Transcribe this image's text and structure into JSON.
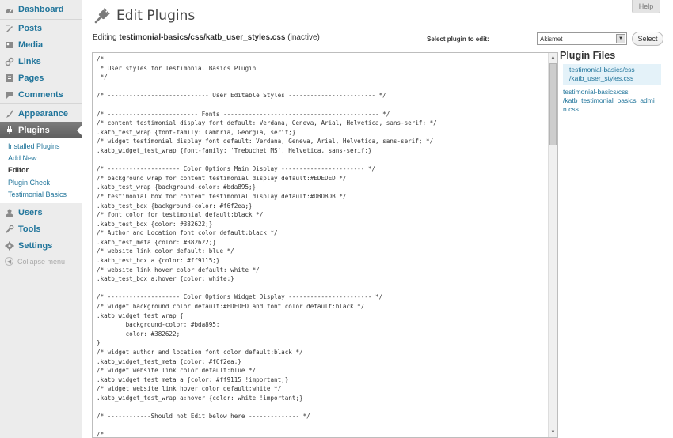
{
  "header": {
    "title": "Edit Plugins",
    "help": "Help",
    "editing_prefix": "Editing",
    "editing_file": "testimonial-basics/css/katb_user_styles.css",
    "editing_status": "(inactive)",
    "select_label": "Select plugin to edit:",
    "select_value": "Akismet",
    "select_button": "Select"
  },
  "sidebar": {
    "items": [
      {
        "label": "Dashboard",
        "icon": "dashboard-icon"
      },
      {
        "label": "Posts",
        "icon": "posts-icon"
      },
      {
        "label": "Media",
        "icon": "media-icon"
      },
      {
        "label": "Links",
        "icon": "links-icon"
      },
      {
        "label": "Pages",
        "icon": "pages-icon"
      },
      {
        "label": "Comments",
        "icon": "comments-icon"
      },
      {
        "label": "Appearance",
        "icon": "appearance-icon"
      },
      {
        "label": "Plugins",
        "icon": "plugins-icon"
      },
      {
        "label": "Users",
        "icon": "users-icon"
      },
      {
        "label": "Tools",
        "icon": "tools-icon"
      },
      {
        "label": "Settings",
        "icon": "settings-icon"
      }
    ],
    "submenu": [
      "Installed Plugins",
      "Add New",
      "Editor",
      "Plugin Check",
      "Testimonial Basics"
    ],
    "collapse": "Collapse menu"
  },
  "editor": {
    "lines": [
      "/*",
      " * User styles for Testimonial Basics Plugin",
      " */",
      "",
      "/* ---------------------------- User Editable Styles ------------------------ */",
      "",
      "/* ------------------------- Fonts ------------------------------------------- */",
      "/* content testimonial display font default: Verdana, Geneva, Arial, Helvetica, sans-serif; */",
      ".katb_test_wrap {font-family: Cambria, Georgia, serif;}",
      "/* widget testimonial display font default: Verdana, Geneva, Arial, Helvetica, sans-serif; */",
      ".katb_widget_test_wrap {font-family: 'Trebuchet MS', Helvetica, sans-serif;}",
      "",
      "/* -------------------- Color Options Main Display ----------------------- */",
      "/* background wrap for content testimonial display default:#EDEDED */",
      ".katb_test_wrap {background-color: #bda895;}",
      "/* testimonial box for content testimonial display default:#DBDBDB */",
      ".katb_test_box {background-color: #f6f2ea;}",
      "/* font color for testimonial default:black */",
      ".katb_test_box {color: #382622;}",
      "/* Author and Location font color default:black */",
      ".katb_test_meta {color: #382622;}",
      "/* website link color default: blue */",
      ".katb_test_box a {color: #ff9115;}",
      "/* website link hover color default: white */",
      ".katb_test_box a:hover {color: white;}",
      "",
      "/* -------------------- Color Options Widget Display ----------------------- */",
      "/* widget background color default:#EDEDED and font color default:black */",
      ".katb_widget_test_wrap {",
      "        background-color: #bda895;",
      "        color: #382622;",
      "}",
      "/* widget author and location font color default:black */",
      ".katb_widget_test_meta {color: #f6f2ea;}",
      "/* widget website link color default:blue */",
      ".katb_widget_test_meta a {color: #ff9115 !important;}",
      "/* widget website link hover color default:white */",
      ".katb_widget_test_wrap a:hover {color: white !important;}",
      "",
      "/* ------------Should not Edit below here -------------- */",
      "",
      "/*"
    ]
  },
  "plugin_files": {
    "heading": "Plugin Files",
    "files": [
      {
        "line1": "testimonial-basics/css",
        "line2": "/katb_user_styles.css"
      },
      {
        "line1": "testimonial-basics/css",
        "line2": "/katb_testimonial_basics_admi",
        "line3": "n.css"
      }
    ]
  },
  "colors": {
    "link": "#21759b",
    "active_menu": "#6d6d6d",
    "sidebar_bg": "#ececec",
    "selected_file_bg": "#e4f2f9"
  }
}
